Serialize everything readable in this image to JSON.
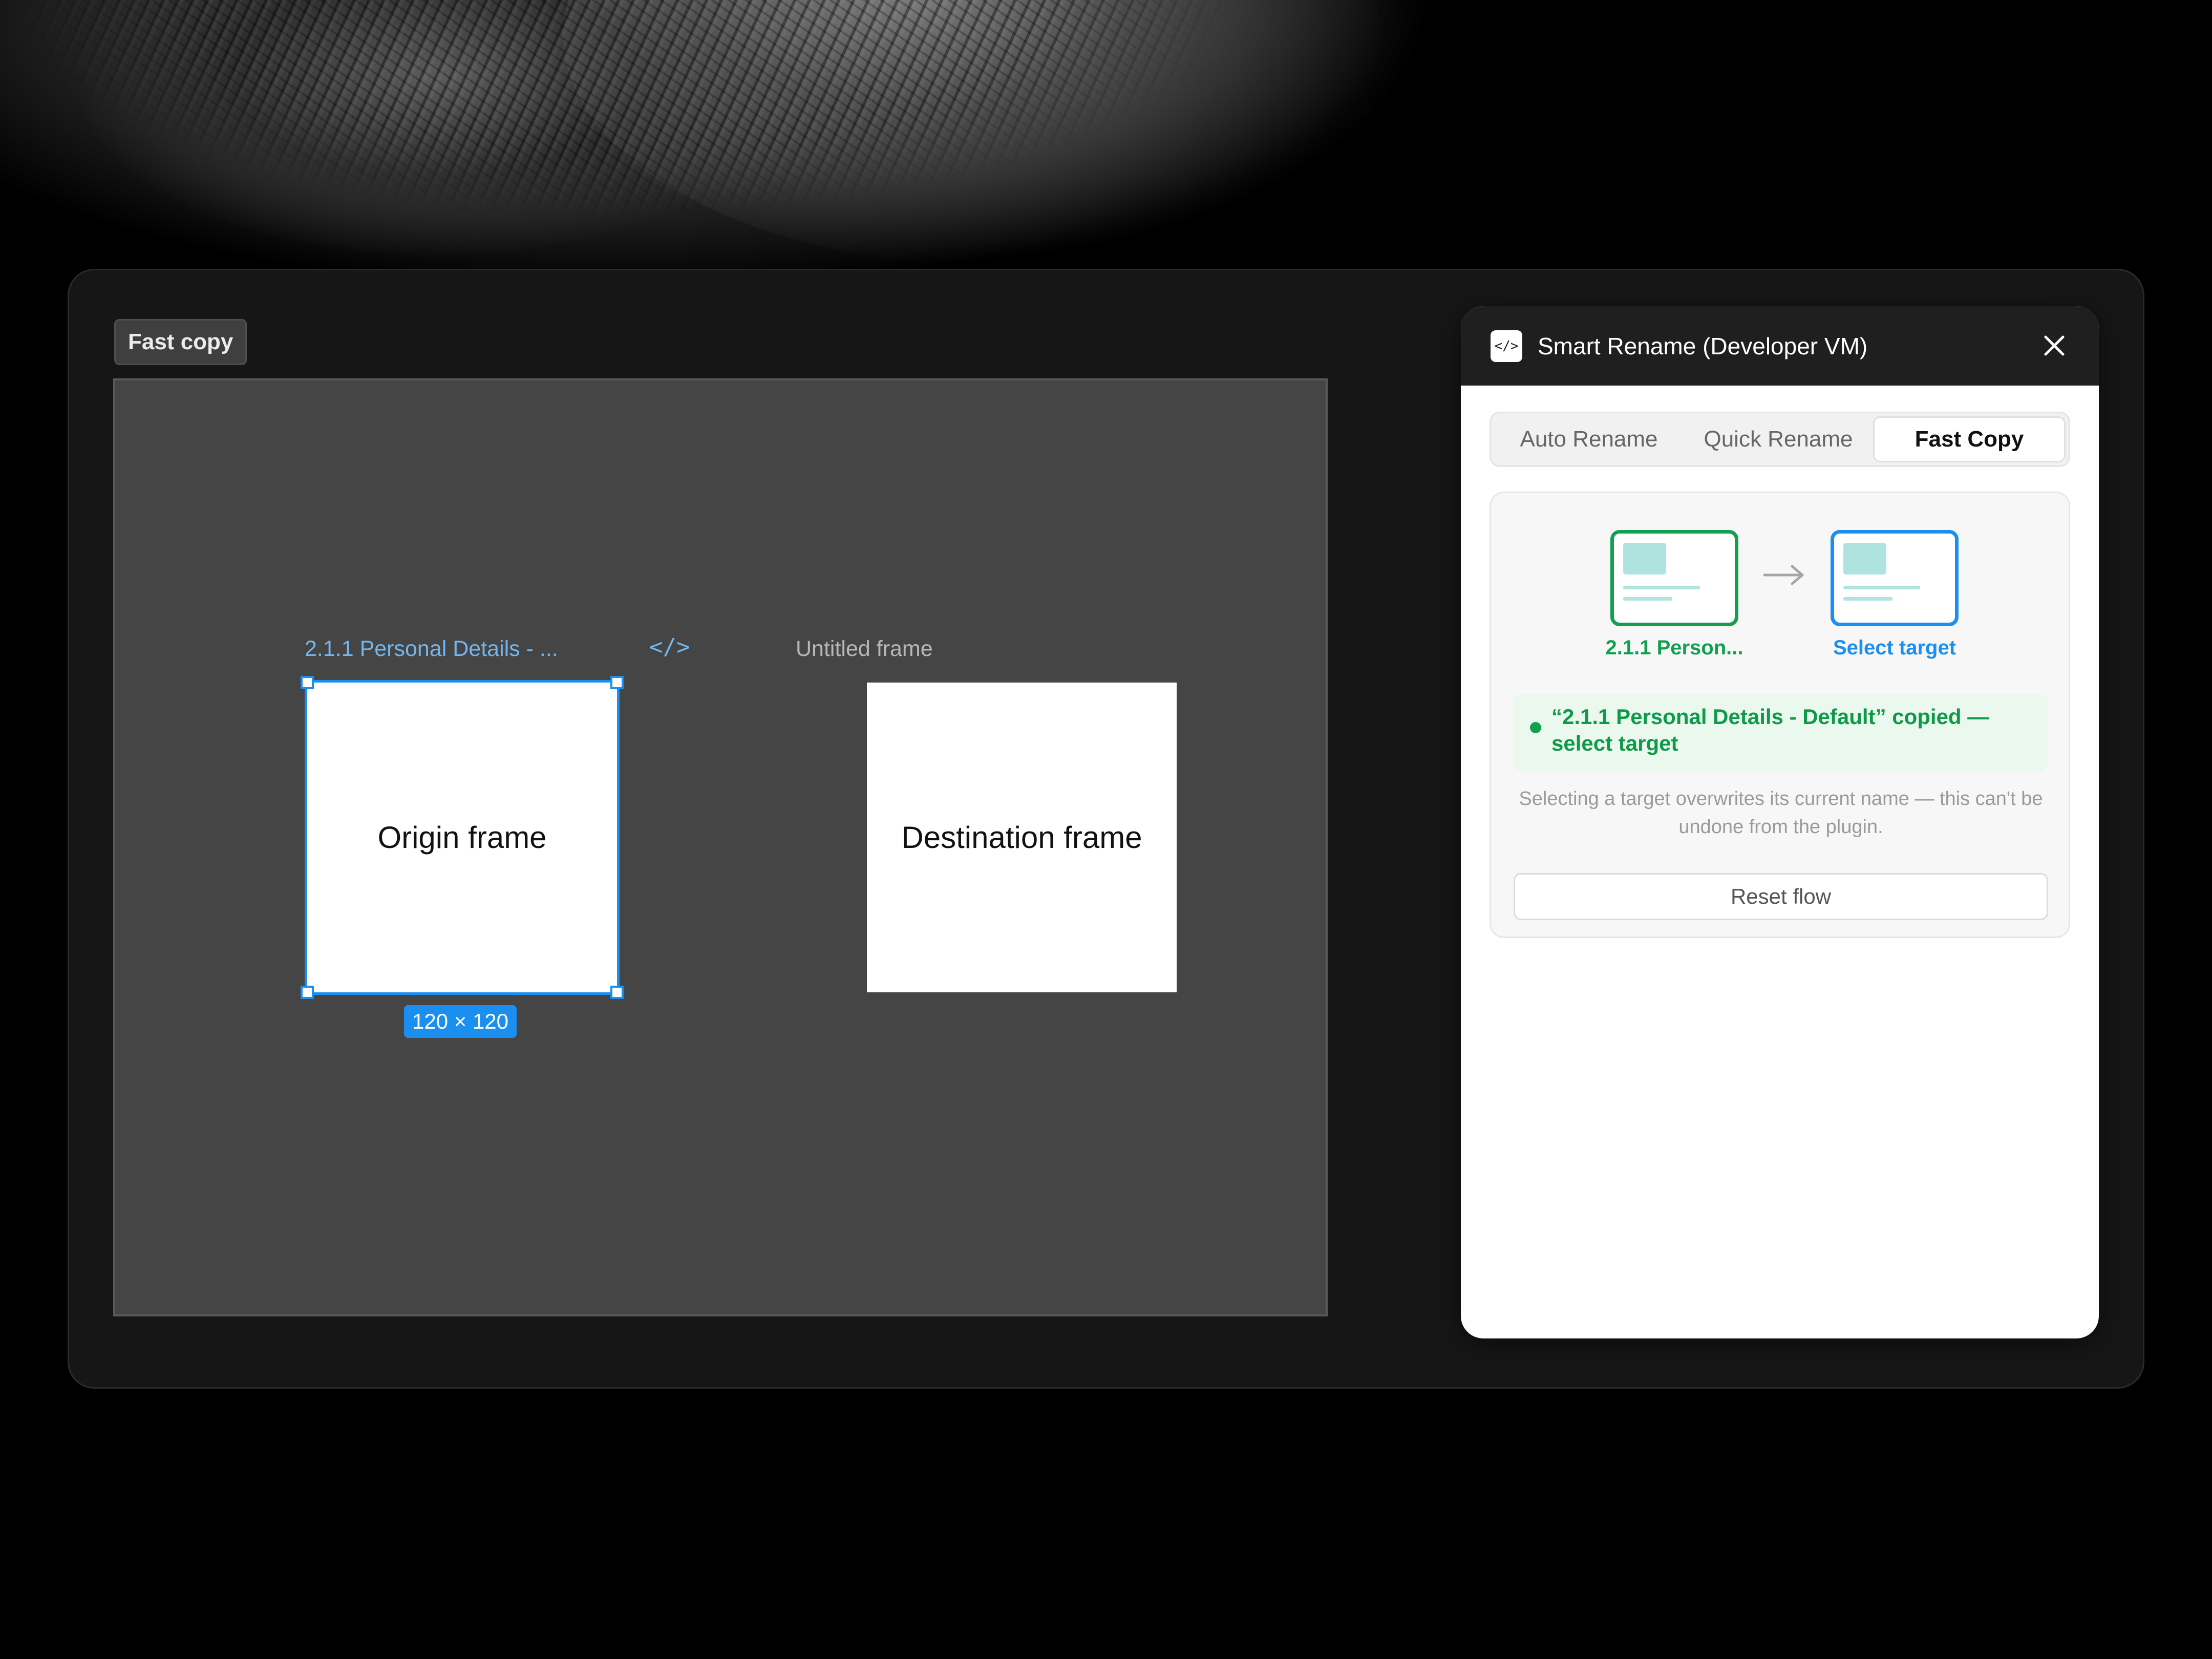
{
  "canvas_tag": "Fast copy",
  "origin": {
    "label": "2.1.1 Personal Details - ...",
    "code_glyph": "</>",
    "frame_text": "Origin frame",
    "size_badge": "120 × 120"
  },
  "destination": {
    "label": "Untitled frame",
    "frame_text": "Destination frame"
  },
  "plugin": {
    "logo_glyph": "</>",
    "title": "Smart Rename (Developer VM)",
    "tabs": [
      {
        "label": "Auto Rename",
        "active": false
      },
      {
        "label": "Quick Rename",
        "active": false
      },
      {
        "label": "Fast Copy",
        "active": true
      }
    ],
    "flow": {
      "source_caption": "2.1.1 Person...",
      "target_caption": "Select target"
    },
    "status": "“2.1.1 Personal Details - Default” copied — select target",
    "hint": "Selecting a target overwrites its current name — this can't be undone from the plugin.",
    "reset_label": "Reset flow"
  },
  "colors": {
    "selection_blue": "#1a8ff0",
    "success_green": "#11a050",
    "canvas_gray": "#454545",
    "panel_header": "#1f1f1f"
  },
  "icons": [
    "code-icon",
    "close-icon",
    "arrow-right-icon",
    "frame-thumbnail-icon",
    "status-dot-icon"
  ]
}
